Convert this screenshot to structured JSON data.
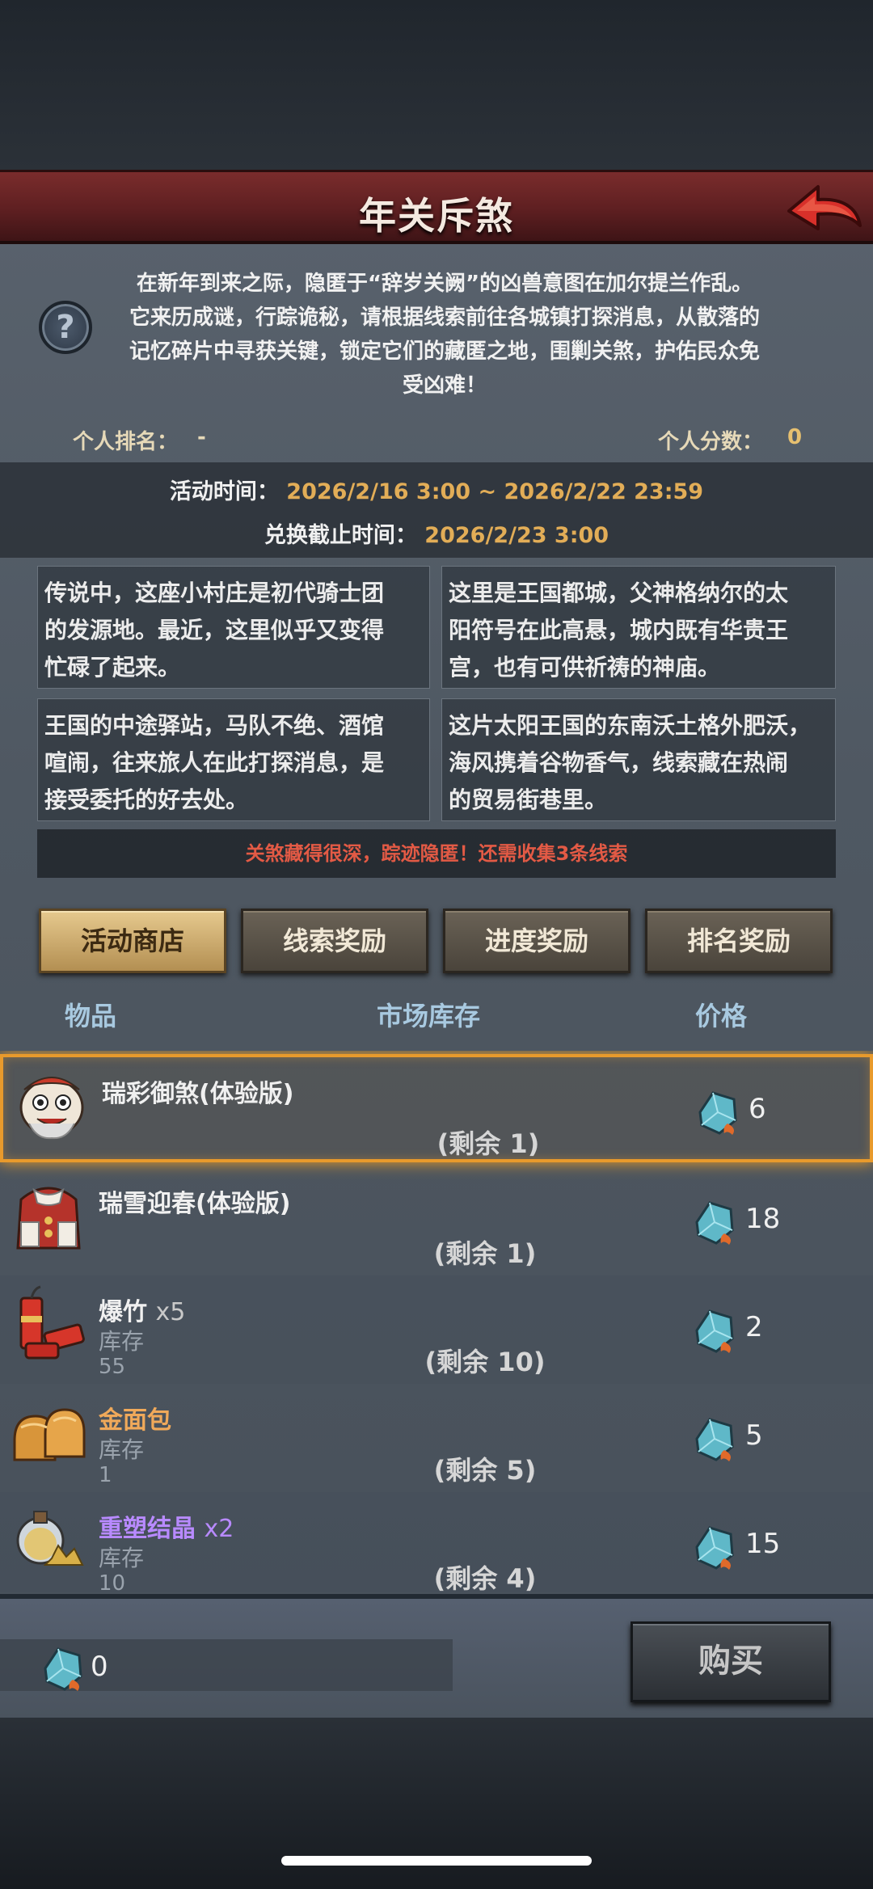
{
  "header": {
    "title": "年关斥煞"
  },
  "intro": {
    "lines": [
      "在新年到来之际，隐匿于“辞岁关阙”的凶兽意图在加尔提兰作乱。",
      "它来历成谜，行踪诡秘，请根据线索前往各城镇打探消息，从散落的",
      "记忆碎片中寻获关键，锁定它们的藏匿之地，围剿关煞，护佑民众免",
      "受凶难！"
    ]
  },
  "rank": {
    "label": "个人排名：",
    "value": "-"
  },
  "score": {
    "label": "个人分数：",
    "value": "0"
  },
  "event_time": {
    "label": "活动时间：",
    "value": "2026/2/16 3:00 ~ 2026/2/22 23:59"
  },
  "exchange_deadline": {
    "label": "兑换截止时间：",
    "value": "2026/2/23 3:00"
  },
  "clues": [
    {
      "lines": [
        "传说中，这座小村庄是初代骑士团",
        "的发源地。最近，这里似乎又变得",
        "忙碌了起来。"
      ]
    },
    {
      "lines": [
        "这里是王国都城，父神格纳尔的太",
        "阳符号在此高悬，城内既有华贵王",
        "宫，也有可供祈祷的神庙。"
      ]
    },
    {
      "lines": [
        "王国的中途驿站，马队不绝、酒馆",
        "喧闹，往来旅人在此打探消息，是",
        "接受委托的好去处。"
      ]
    },
    {
      "lines": [
        "这片太阳王国的东南沃土格外肥沃，",
        "海风携着谷物香气，线索藏在热闹",
        "的贸易街巷里。"
      ]
    }
  ],
  "clue_notice": "关煞藏得很深，踪迹隐匿！还需收集3条线索",
  "tabs": [
    {
      "label": "活动商店",
      "active": true
    },
    {
      "label": "线索奖励",
      "active": false
    },
    {
      "label": "进度奖励",
      "active": false
    },
    {
      "label": "排名奖励",
      "active": false
    }
  ],
  "columns": {
    "item": "物品",
    "stock": "市场库存",
    "price": "价格"
  },
  "items": [
    {
      "name": "瑞彩御煞(体验版)",
      "qty": "",
      "stock_label": "",
      "stock_value": "",
      "remain": "(剩余 1)",
      "price": "6",
      "icon": "lion-dance-icon",
      "color": "white"
    },
    {
      "name": "瑞雪迎春(体验版)",
      "qty": "",
      "stock_label": "",
      "stock_value": "",
      "remain": "(剩余 1)",
      "price": "18",
      "icon": "red-costume-icon",
      "color": "white"
    },
    {
      "name": "爆竹",
      "qty": "x5",
      "stock_label": "库存",
      "stock_value": "55",
      "remain": "(剩余 10)",
      "price": "2",
      "icon": "firecracker-icon",
      "color": "white"
    },
    {
      "name": "金面包",
      "qty": "",
      "stock_label": "库存",
      "stock_value": "1",
      "remain": "(剩余 5)",
      "price": "5",
      "icon": "bread-icon",
      "color": "orange"
    },
    {
      "name": "重塑结晶",
      "qty": "x2",
      "stock_label": "库存",
      "stock_value": "10",
      "remain": "(剩余 4)",
      "price": "15",
      "icon": "crystal-flask-icon",
      "color": "purple"
    }
  ],
  "balance": {
    "value": "0",
    "icon": "crystal-currency-icon"
  },
  "buy_button": "购买",
  "colors": {
    "accent_gold": "#e2ad57",
    "notice_red": "#e35a45",
    "rare_purple": "#b88aff",
    "selection_orange": "#e89a2c"
  }
}
